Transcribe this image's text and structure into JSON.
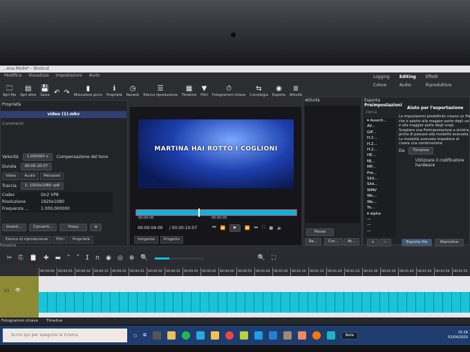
{
  "window": {
    "title": "...ena Modo* - Shotcut"
  },
  "menu": [
    "Modifica",
    "Visualizza",
    "Impostazioni",
    "Aiuto"
  ],
  "toolbar": [
    {
      "label": "Apri file",
      "icon": "folder"
    },
    {
      "label": "Apri altro",
      "icon": "open-other"
    },
    {
      "label": "Salva",
      "icon": "save"
    },
    {
      "label": "",
      "icon": "undo"
    },
    {
      "label": "",
      "icon": "redo"
    },
    {
      "label": "Misuratore picco",
      "icon": "meter"
    },
    {
      "label": "Proprietà",
      "icon": "info"
    },
    {
      "label": "Recenti",
      "icon": "clock"
    },
    {
      "label": "Elenco riproduzione",
      "icon": "list"
    },
    {
      "label": "Timeline",
      "icon": "timeline"
    },
    {
      "label": "Filtri",
      "icon": "filter"
    },
    {
      "label": "Fotogrammi chiave",
      "icon": "stopwatch"
    },
    {
      "label": "Cronologia",
      "icon": "history"
    },
    {
      "label": "Esporta",
      "icon": "export"
    },
    {
      "label": "Attività",
      "icon": "jobs"
    }
  ],
  "layouts": [
    "Logging",
    "Editing",
    "Effetti",
    "Colore",
    "Audio",
    "Riproduttore"
  ],
  "active_layout": "Editing",
  "properties": {
    "header": "Proprietà",
    "clip": "video (1).mkv",
    "section": "Commenti",
    "speed_label": "Velocità",
    "speed": "1,000000 x",
    "pitch": "Compensazione del tono",
    "duration_label": "Durata",
    "duration": "00:00:10:07",
    "tabs": [
      "Video",
      "Audio",
      "Metadati"
    ],
    "track_label": "Traccia",
    "track": "1: 1920x1080 vp8",
    "info": [
      [
        "Codec",
        "On2 VP8"
      ],
      [
        "Risoluzione",
        "1920x1080"
      ],
      [
        "Frequenza ...",
        "1.000,000000"
      ]
    ],
    "buttons": [
      "Inverti...",
      "Converti...",
      "Proxy"
    ],
    "bottom_tabs": [
      "Elenco di riproduzione",
      "Filtri",
      "Proprietà"
    ]
  },
  "player": {
    "overlay_text": "MARTINA HAI ROTTO I COGLIONI",
    "ruler": [
      "00:00:00",
      "00:00:05"
    ],
    "timecode": "00:00:04:00",
    "total": "/ 00:00:10:07",
    "tabs": [
      "Sorgente",
      "Progetto"
    ],
    "progress": 0.39
  },
  "activity": {
    "title": "Attività",
    "pause": "Pausa",
    "buttons": [
      "Re...",
      "Cro...",
      "At..."
    ]
  },
  "export": {
    "title": "Esporta",
    "presets_label": "Preimpostazioni",
    "search": "cerca",
    "presets": [
      "▾ Assorti...",
      "AV...",
      "GIF...",
      "H.2...",
      "H.2...",
      "H.2...",
      "HE...",
      "MJ...",
      "MP...",
      "Pre...",
      "Slid...",
      "Slid...",
      "WMV",
      "We...",
      "We...",
      "Yo...",
      "▾ alpha",
      "—",
      "—",
      "—"
    ],
    "help_title": "Aiuto per l'esportazione",
    "help": "Le impostazioni predefinite creano un file che è adatto alla maggior parte degli usi e alla maggior parte degli scopi. Scegliere una Preimpostazione a sinistra prima di passare alla modalità avanzata. La modalità avanzata impedisce di creare una combinazione",
    "from_label": "Da",
    "from": "Timeline",
    "hw": "Utilizzare il codificatore hardware",
    "export_btn": "Esporta file",
    "reset_btn": "Ripristina"
  },
  "timeline": {
    "header": "Timeline",
    "zoom": 0.3,
    "ruler": [
      "00:00:00",
      "00:00:05",
      "00:00:10",
      "00:00:15",
      "00:00:20",
      "00:00:25",
      "00:00:30",
      "00:00:35",
      "00:00:40",
      "00:00:45",
      "00:00:50",
      "00:00:55",
      "00:01:00",
      "00:01:05",
      "00:01:10",
      "00:01:15",
      "00:01:20",
      "00:01:25",
      "00:01:30",
      "00:01:35",
      "00:01:40",
      "00:01:45",
      "00:01:50",
      "00:01:55"
    ],
    "track": "V1",
    "bottom_tabs": [
      "Fotogrammi chiave",
      "Timeline"
    ]
  },
  "taskbar": {
    "search": "Scrivi qui per eseguire la ricerca",
    "network": "Rete",
    "time": "15:18",
    "date": "02/04/2020"
  }
}
